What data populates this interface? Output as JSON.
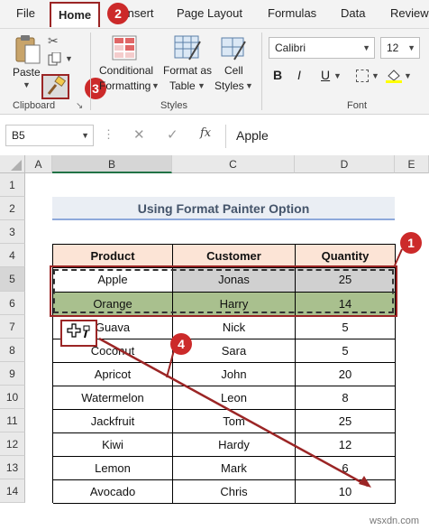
{
  "tabs": [
    "File",
    "Home",
    "Insert",
    "Page Layout",
    "Formulas",
    "Data",
    "Review"
  ],
  "ribbon": {
    "paste": "Paste",
    "conditional_formatting": [
      "Conditional",
      "Formatting"
    ],
    "format_as_table": [
      "Format as",
      "Table"
    ],
    "cell_styles": [
      "Cell",
      "Styles"
    ],
    "font_name": "Calibri",
    "font_size": "12",
    "bold": "B",
    "italic": "I",
    "underline": "U",
    "groups": {
      "clipboard": "Clipboard",
      "styles": "Styles",
      "font": "Font"
    }
  },
  "formula_bar": {
    "name_box": "B5",
    "fx": "fx",
    "value": "Apple"
  },
  "sheet": {
    "columns": [
      "A",
      "B",
      "C",
      "D",
      "E"
    ],
    "rows": [
      "1",
      "2",
      "3",
      "4",
      "5",
      "6",
      "7",
      "8",
      "9",
      "10",
      "11",
      "12",
      "13",
      "14"
    ],
    "title": "Using Format Painter Option",
    "headers": [
      "Product",
      "Customer",
      "Quantity"
    ],
    "data": [
      [
        "Apple",
        "Jonas",
        "25"
      ],
      [
        "Orange",
        "Harry",
        "14"
      ],
      [
        "Guava",
        "Nick",
        "5"
      ],
      [
        "Coconut",
        "Sara",
        "5"
      ],
      [
        "Apricot",
        "John",
        "20"
      ],
      [
        "Watermelon",
        "Leon",
        "8"
      ],
      [
        "Jackfruit",
        "Tom",
        "25"
      ],
      [
        "Kiwi",
        "Hardy",
        "12"
      ],
      [
        "Lemon",
        "Mark",
        "6"
      ],
      [
        "Avocado",
        "Chris",
        "10"
      ]
    ]
  },
  "annotations": [
    "1",
    "2",
    "3",
    "4"
  ],
  "watermark": "wsxdn.com",
  "colors": {
    "header_fill": "#fce4d6",
    "row5_fill": "#d0d0d0",
    "row6_fill": "#a9c08e",
    "accent_red": "#9b2525",
    "badge_red": "#cc2a2a",
    "title_color": "#44546a"
  }
}
